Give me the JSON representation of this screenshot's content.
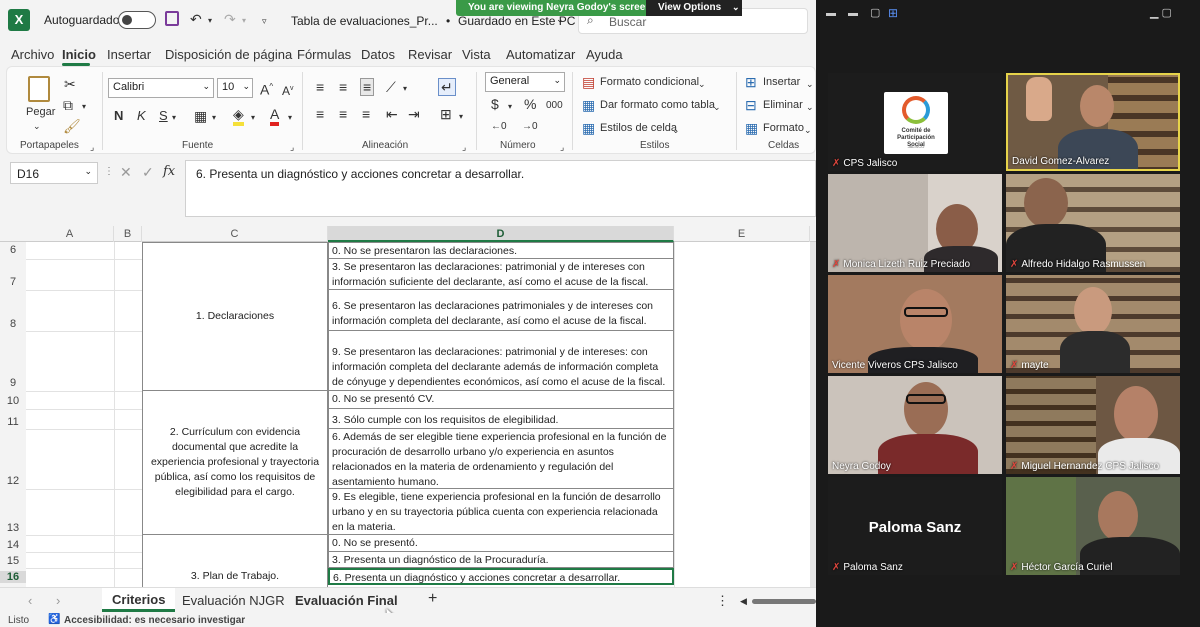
{
  "excel": {
    "title_bar": {
      "autosave_label": "Autoguardado",
      "file_name": "Tabla de evaluaciones_Pr...",
      "save_status": "Guardado en Este PC",
      "search_placeholder": "Buscar"
    },
    "share_banner": {
      "text": "You are viewing Neyra Godoy's screen",
      "button": "View Options"
    },
    "menu": [
      "Archivo",
      "Inicio",
      "Insertar",
      "Disposición de página",
      "Fórmulas",
      "Datos",
      "Revisar",
      "Vista",
      "Automatizar",
      "Ayuda"
    ],
    "active_menu": "Inicio",
    "ribbon": {
      "clipboard": {
        "paste": "Pegar",
        "group": "Portapapeles"
      },
      "font": {
        "name": "Calibri",
        "size": "10",
        "bold": "N",
        "italic": "K",
        "underline": "S",
        "group": "Fuente"
      },
      "alignment": {
        "group": "Alineación"
      },
      "number": {
        "format": "General",
        "currency": "$",
        "percent": "%",
        "thousands": "000",
        "group": "Número"
      },
      "styles": {
        "conditional": "Formato condicional",
        "table": "Dar formato como tabla",
        "cell_styles": "Estilos de celda",
        "group": "Estilos"
      },
      "cells": {
        "insert": "Insertar",
        "delete": "Eliminar",
        "format": "Formato",
        "group": "Celdas"
      }
    },
    "formula_bar": {
      "cell_ref": "D16",
      "fx": "fx",
      "content": "6. Presenta un diagnóstico y acciones concretar a desarrollar."
    },
    "columns": [
      "A",
      "B",
      "C",
      "D",
      "E"
    ],
    "rows": [
      {
        "num": "6",
        "d": "0. No se presentaron las declaraciones."
      },
      {
        "num": "7",
        "d": "3. Se presentaron las declaraciones: patrimonial y de intereses con información suficiente del declarante, así como el acuse de la fiscal."
      },
      {
        "num": "8",
        "d": "6. Se presentaron las declaraciones patrimoniales y de intereses con información completa del declarante, así como el acuse de la fiscal."
      },
      {
        "num": "9",
        "d": "9. Se presentaron las declaraciones: patrimonial y de intereses: con información completa del declarante además de información completa de cónyuge y dependientes económicos, así como el acuse de la fiscal."
      },
      {
        "num": "10",
        "d": "0. No se presentó CV."
      },
      {
        "num": "11",
        "d": "3. Sólo cumple con los requisitos de elegibilidad."
      },
      {
        "num": "12",
        "d": "6. Además de ser elegible tiene experiencia profesional en la función de procuración de desarrollo urbano y/o experiencia en asuntos relacionados en la materia de ordenamiento y regulación del asentamiento humano."
      },
      {
        "num": "13",
        "d": "9. Es elegible, tiene experiencia profesional en la función de desarrollo urbano y en su trayectoria pública cuenta con experiencia relacionada en la materia."
      },
      {
        "num": "14",
        "d": "0. No se presentó."
      },
      {
        "num": "15",
        "d": "3. Presenta un diagnóstico de la Procuraduría."
      },
      {
        "num": "16",
        "d": "6. Presenta un diagnóstico y acciones concretar a desarrollar."
      }
    ],
    "criteria": [
      "1. Declaraciones",
      "2. Currículum con evidencia documental que acredite la experiencia profesional y trayectoria pública, así como los requisitos de elegibilidad para el cargo.",
      "3. Plan de Trabajo."
    ],
    "sheet_tabs": [
      "Criterios",
      "Evaluación NJGR",
      "Evaluación Final"
    ],
    "active_tab": "Criterios",
    "status": {
      "mode": "Listo",
      "accessibility": "Accesibilidad: es necesario investigar"
    }
  },
  "zoom": {
    "participants": [
      {
        "name": "CPS Jalisco",
        "logo_text": "Comité de Participación Social",
        "logo_sub": "JALISCO"
      },
      {
        "name": "David Gomez-Alvarez"
      },
      {
        "name": "Monica Lizeth Ruiz Preciado"
      },
      {
        "name": "Alfredo Hidalgo Rasmussen"
      },
      {
        "name": "Vicente Viveros CPS Jalisco"
      },
      {
        "name": "mayte"
      },
      {
        "name": "Neyra Godoy"
      },
      {
        "name": "Miguel Hernandez CPS Jalisco"
      },
      {
        "name": "Paloma Sanz",
        "big_label": "Paloma Sanz"
      },
      {
        "name": "Héctor García Curiel"
      }
    ],
    "colors": {
      "active_speaker_border": "#e6d34a",
      "muted_icon": "#e0463d"
    }
  }
}
